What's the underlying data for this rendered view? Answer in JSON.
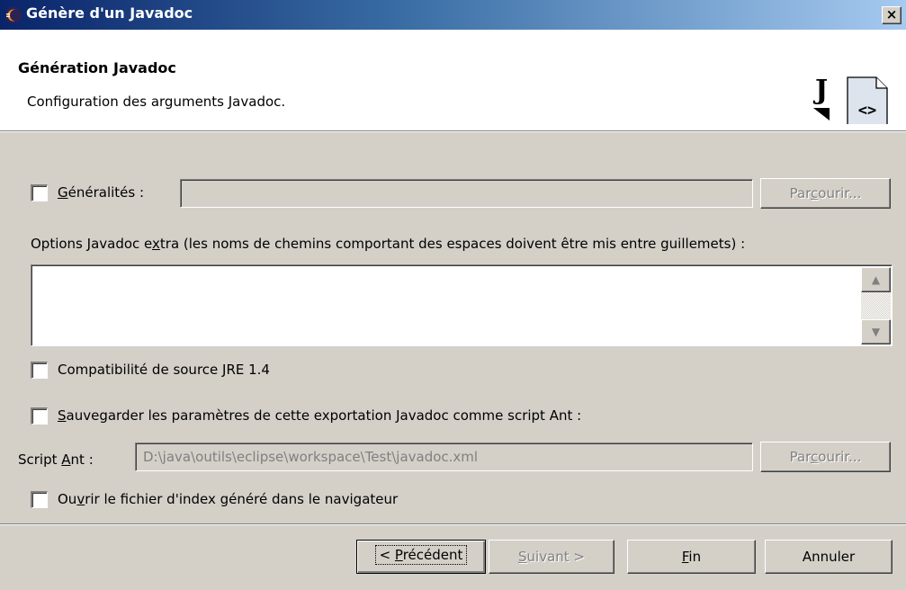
{
  "window": {
    "title": "Génère d'un Javadoc",
    "close_glyph": "×"
  },
  "header": {
    "title": "Génération Javadoc",
    "description": "Configuration des arguments Javadoc.",
    "logo_letter": "J",
    "logo_symbol": "<>"
  },
  "general": {
    "checked": false,
    "label_accel": "G",
    "label_rest": "énéralités :",
    "value": "",
    "browse_pre": "Par",
    "browse_accel": "c",
    "browse_post": "ourir..."
  },
  "extra_options": {
    "label_pre": "Options Javadoc e",
    "label_accel": "x",
    "label_post": "tra (les noms de chemins comportant des espaces doivent être mis entre guillemets) :",
    "value": "",
    "scroll_up": "▲",
    "scroll_down": "▼"
  },
  "jre14": {
    "checked": false,
    "label": "Compatibilité de source JRE 1.4"
  },
  "save_ant": {
    "checked": false,
    "label_accel": "S",
    "label_rest": "auvegarder les paramètres de cette exportation Javadoc comme script Ant :"
  },
  "ant_script": {
    "label_pre": "Script ",
    "label_accel": "A",
    "label_post": "nt :",
    "value": "D:\\java\\outils\\eclipse\\workspace\\Test\\javadoc.xml",
    "browse_pre": "Par",
    "browse_accel": "c",
    "browse_post": "ourir..."
  },
  "open_index": {
    "checked": false,
    "label_pre": "Ou",
    "label_accel": "v",
    "label_post": "rir le fichier d'index généré dans le navigateur"
  },
  "buttons": {
    "back_pre": "< ",
    "back_accel": "P",
    "back_post": "récédent",
    "next_accel": "S",
    "next_post": "uivant >",
    "finish_accel": "F",
    "finish_post": "in",
    "cancel": "Annuler"
  }
}
